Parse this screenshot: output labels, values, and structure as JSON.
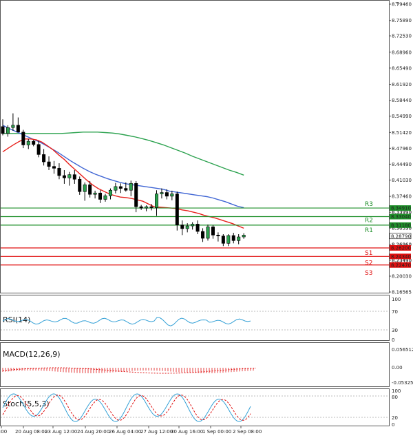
{
  "price_axis": [
    "8.79460",
    "8.75890",
    "8.72530",
    "8.68960",
    "8.65490",
    "8.61920",
    "8.58440",
    "8.54990",
    "8.51420",
    "8.47960",
    "8.44490",
    "8.41030",
    "8.37460",
    "8.33990",
    "8.30530",
    "8.26960",
    "8.23490",
    "8.20030",
    "8.16565"
  ],
  "price_range": [
    8.16565,
    8.7946
  ],
  "x_labels": [
    "00:00",
    "20 Aug 08:00",
    "23 Aug 12:00",
    "24 Aug 20:00",
    "26 Aug 04:00",
    "27 Aug 12:00",
    "30 Aug 16:00",
    "1 Sep 00:00",
    "2 Sep 08:00"
  ],
  "levels": {
    "resistance": [
      {
        "name": "R3",
        "value": "8.34910"
      },
      {
        "name": "R2",
        "value": "8.33040"
      },
      {
        "name": "R1",
        "value": "8.31180"
      }
    ],
    "support": [
      {
        "name": "S1",
        "value": "8.26200"
      },
      {
        "name": "S2",
        "value": "8.24340"
      },
      {
        "name": "S3",
        "value": "8.22470"
      }
    ],
    "last_price": "8.28790",
    "overlap_labels": [
      "8.33990",
      "8.30530",
      "8.26960",
      "8.23490"
    ]
  },
  "indicators": {
    "rsi": {
      "label": "RSI(14)",
      "axis": [
        "100",
        "70",
        "30",
        "0"
      ]
    },
    "macd": {
      "label": "MACD(12,26,9)",
      "axis": [
        "0.056512",
        "0.00",
        "-0.053258"
      ]
    },
    "stoch": {
      "label": "Stoch(5,5,3)",
      "axis": [
        "100",
        "80",
        "20",
        "0"
      ]
    }
  },
  "colors": {
    "ma_fast": "#e8211c",
    "ma_mid": "#3f65d4",
    "ma_slow": "#2ca24f",
    "resistance": "#1f8f2a",
    "support": "#e01010",
    "rsi": "#33a0d6",
    "macd": "#e01010"
  },
  "chart_data": {
    "type": "candlestick",
    "price_range": [
      8.16565,
      8.7946
    ],
    "candles": [
      {
        "o": 8.527,
        "h": 8.543,
        "l": 8.508,
        "c": 8.512
      },
      {
        "o": 8.512,
        "h": 8.53,
        "l": 8.505,
        "c": 8.525
      },
      {
        "o": 8.525,
        "h": 8.556,
        "l": 8.518,
        "c": 8.53
      },
      {
        "o": 8.53,
        "h": 8.547,
        "l": 8.523,
        "c": 8.515
      },
      {
        "o": 8.515,
        "h": 8.52,
        "l": 8.48,
        "c": 8.487
      },
      {
        "o": 8.487,
        "h": 8.5,
        "l": 8.478,
        "c": 8.495
      },
      {
        "o": 8.495,
        "h": 8.498,
        "l": 8.484,
        "c": 8.488
      },
      {
        "o": 8.488,
        "h": 8.496,
        "l": 8.46,
        "c": 8.466
      },
      {
        "o": 8.466,
        "h": 8.478,
        "l": 8.442,
        "c": 8.45
      },
      {
        "o": 8.45,
        "h": 8.462,
        "l": 8.432,
        "c": 8.44
      },
      {
        "o": 8.44,
        "h": 8.452,
        "l": 8.424,
        "c": 8.436
      },
      {
        "o": 8.436,
        "h": 8.447,
        "l": 8.412,
        "c": 8.42
      },
      {
        "o": 8.42,
        "h": 8.432,
        "l": 8.402,
        "c": 8.415
      },
      {
        "o": 8.415,
        "h": 8.428,
        "l": 8.398,
        "c": 8.422
      },
      {
        "o": 8.422,
        "h": 8.432,
        "l": 8.402,
        "c": 8.412
      },
      {
        "o": 8.412,
        "h": 8.418,
        "l": 8.378,
        "c": 8.385
      },
      {
        "o": 8.385,
        "h": 8.405,
        "l": 8.365,
        "c": 8.4
      },
      {
        "o": 8.4,
        "h": 8.408,
        "l": 8.372,
        "c": 8.379
      },
      {
        "o": 8.379,
        "h": 8.387,
        "l": 8.37,
        "c": 8.382
      },
      {
        "o": 8.382,
        "h": 8.388,
        "l": 8.36,
        "c": 8.368
      },
      {
        "o": 8.368,
        "h": 8.38,
        "l": 8.363,
        "c": 8.376
      },
      {
        "o": 8.376,
        "h": 8.392,
        "l": 8.368,
        "c": 8.388
      },
      {
        "o": 8.388,
        "h": 8.404,
        "l": 8.381,
        "c": 8.396
      },
      {
        "o": 8.396,
        "h": 8.403,
        "l": 8.382,
        "c": 8.392
      },
      {
        "o": 8.392,
        "h": 8.405,
        "l": 8.385,
        "c": 8.388
      },
      {
        "o": 8.388,
        "h": 8.409,
        "l": 8.375,
        "c": 8.403
      },
      {
        "o": 8.403,
        "h": 8.408,
        "l": 8.34,
        "c": 8.352
      },
      {
        "o": 8.352,
        "h": 8.356,
        "l": 8.345,
        "c": 8.349
      },
      {
        "o": 8.349,
        "h": 8.355,
        "l": 8.342,
        "c": 8.352
      },
      {
        "o": 8.352,
        "h": 8.358,
        "l": 8.344,
        "c": 8.35
      },
      {
        "o": 8.35,
        "h": 8.388,
        "l": 8.332,
        "c": 8.38
      },
      {
        "o": 8.38,
        "h": 8.392,
        "l": 8.37,
        "c": 8.383
      },
      {
        "o": 8.383,
        "h": 8.39,
        "l": 8.368,
        "c": 8.375
      },
      {
        "o": 8.375,
        "h": 8.387,
        "l": 8.366,
        "c": 8.38
      },
      {
        "o": 8.38,
        "h": 8.385,
        "l": 8.3,
        "c": 8.312
      },
      {
        "o": 8.312,
        "h": 8.322,
        "l": 8.29,
        "c": 8.304
      },
      {
        "o": 8.304,
        "h": 8.316,
        "l": 8.296,
        "c": 8.31
      },
      {
        "o": 8.31,
        "h": 8.318,
        "l": 8.302,
        "c": 8.314
      },
      {
        "o": 8.314,
        "h": 8.322,
        "l": 8.292,
        "c": 8.298
      },
      {
        "o": 8.298,
        "h": 8.305,
        "l": 8.275,
        "c": 8.283
      },
      {
        "o": 8.283,
        "h": 8.313,
        "l": 8.278,
        "c": 8.308
      },
      {
        "o": 8.308,
        "h": 8.312,
        "l": 8.282,
        "c": 8.29
      },
      {
        "o": 8.29,
        "h": 8.296,
        "l": 8.276,
        "c": 8.288
      },
      {
        "o": 8.288,
        "h": 8.292,
        "l": 8.266,
        "c": 8.272
      },
      {
        "o": 8.272,
        "h": 8.292,
        "l": 8.266,
        "c": 8.289
      },
      {
        "o": 8.289,
        "h": 8.295,
        "l": 8.272,
        "c": 8.278
      },
      {
        "o": 8.278,
        "h": 8.292,
        "l": 8.27,
        "c": 8.286
      },
      {
        "o": 8.286,
        "h": 8.294,
        "l": 8.282,
        "c": 8.29
      }
    ],
    "ma_fast": [
      8.472,
      8.48,
      8.488,
      8.495,
      8.5,
      8.5,
      8.498,
      8.493,
      8.485,
      8.476,
      8.465,
      8.455,
      8.443,
      8.432,
      8.421,
      8.41,
      8.4,
      8.392,
      8.386,
      8.38,
      8.376,
      8.373,
      8.372,
      8.37,
      8.367,
      8.364,
      8.358,
      8.352,
      8.351,
      8.35,
      8.349,
      8.348,
      8.345,
      8.343,
      8.34,
      8.337,
      8.333,
      8.33,
      8.327,
      8.323,
      8.319,
      8.315,
      8.31,
      8.305
    ],
    "ma_mid": [
      8.53,
      8.523,
      8.517,
      8.511,
      8.505,
      8.499,
      8.493,
      8.486,
      8.478,
      8.47,
      8.461,
      8.452,
      8.444,
      8.436,
      8.429,
      8.423,
      8.418,
      8.413,
      8.409,
      8.405,
      8.402,
      8.4,
      8.398,
      8.396,
      8.394,
      8.392,
      8.39,
      8.386,
      8.384,
      8.382,
      8.38,
      8.378,
      8.376,
      8.374,
      8.371,
      8.367,
      8.363,
      8.358,
      8.353,
      8.35
    ],
    "ma_slow": [
      8.512,
      8.512,
      8.512,
      8.512,
      8.512,
      8.512,
      8.512,
      8.512,
      8.512,
      8.513,
      8.514,
      8.515,
      8.515,
      8.515,
      8.514,
      8.513,
      8.511,
      8.508,
      8.505,
      8.501,
      8.497,
      8.492,
      8.487,
      8.481,
      8.475,
      8.469,
      8.462,
      8.456,
      8.45,
      8.444,
      8.438,
      8.432,
      8.427,
      8.421
    ]
  }
}
